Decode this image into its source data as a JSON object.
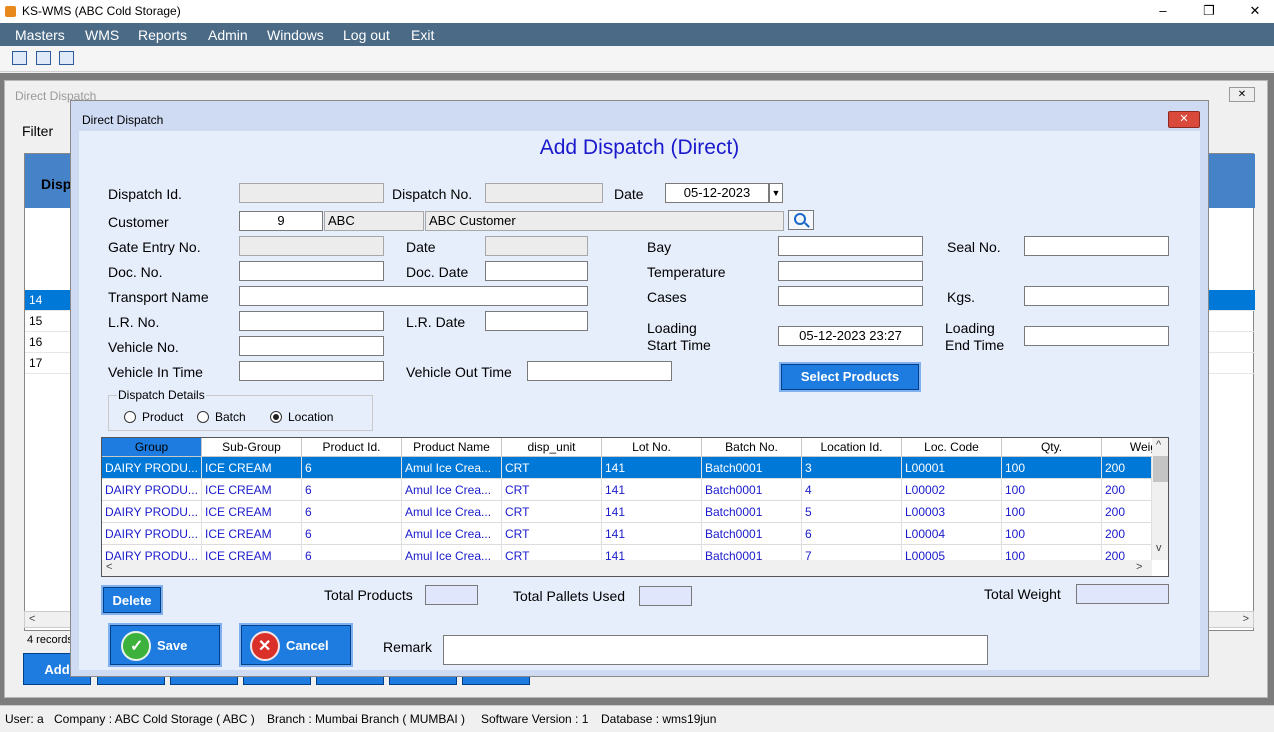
{
  "app": {
    "title": "KS-WMS (ABC Cold Storage)",
    "controls": {
      "minimize": "–",
      "restore": "❐",
      "close": "✕"
    }
  },
  "menu": [
    "Masters",
    "WMS",
    "Reports",
    "Admin",
    "Windows",
    "Log out",
    "Exit"
  ],
  "toolbar": {
    "icons": [
      "edit-icon",
      "list-icon",
      "report-icon"
    ]
  },
  "background_window": {
    "title": "Direct Dispatch",
    "filter_label": "Filter",
    "grid_header": "Disp",
    "rows": [
      "14",
      "15",
      "16",
      "17"
    ],
    "selected_row": "14",
    "records_label": "4 records",
    "add_label": "Add"
  },
  "dialog": {
    "title": "Direct Dispatch",
    "close": "✕",
    "heading": "Add Dispatch (Direct)",
    "labels": {
      "dispatch_id": "Dispatch Id.",
      "dispatch_no": "Dispatch No.",
      "date": "Date",
      "customer": "Customer",
      "gate_entry_no": "Gate Entry No.",
      "gate_date": "Date",
      "bay": "Bay",
      "seal_no": "Seal No.",
      "doc_no": "Doc. No.",
      "doc_date": "Doc. Date",
      "temperature": "Temperature",
      "transport_name": "Transport Name",
      "cases": "Cases",
      "kgs": "Kgs.",
      "lr_no": "L.R. No.",
      "lr_date": "L.R. Date",
      "loading_start_time": [
        "Loading",
        "Start Time"
      ],
      "loading_end_time": [
        "Loading",
        "End Time"
      ],
      "vehicle_no": "Vehicle No.",
      "vehicle_in_time": "Vehicle In Time",
      "vehicle_out_time": "Vehicle Out Time"
    },
    "values": {
      "dispatch_id": "",
      "dispatch_no": "",
      "date": "05-12-2023",
      "customer_id": "9",
      "customer_code": "ABC",
      "customer_name": "ABC Customer",
      "gate_entry_no": "",
      "gate_date": "",
      "bay": "",
      "seal_no": "",
      "doc_no": "",
      "doc_date": "",
      "temperature": "",
      "transport_name": "",
      "cases": "",
      "kgs": "",
      "lr_no": "",
      "lr_date": "",
      "loading_start_time": "05-12-2023 23:27",
      "loading_end_time": "",
      "vehicle_no": "",
      "vehicle_in_time": "",
      "vehicle_out_time": ""
    },
    "select_products_label": "Select Products",
    "dispatch_details": {
      "legend": "Dispatch Details",
      "options": [
        "Product",
        "Batch",
        "Location"
      ],
      "selected": "Location"
    },
    "grid": {
      "columns": [
        "Group",
        "Sub-Group",
        "Product Id.",
        "Product Name",
        "disp_unit",
        "Lot No.",
        "Batch No.",
        "Location Id.",
        "Loc. Code",
        "Qty.",
        "Weig"
      ],
      "rows": [
        [
          "DAIRY PRODU...",
          "ICE CREAM",
          "6",
          "Amul Ice Crea...",
          "CRT",
          "141",
          "Batch0001",
          "3",
          "L00001",
          "100",
          "200"
        ],
        [
          "DAIRY PRODU...",
          "ICE CREAM",
          "6",
          "Amul Ice Crea...",
          "CRT",
          "141",
          "Batch0001",
          "4",
          "L00002",
          "100",
          "200"
        ],
        [
          "DAIRY PRODU...",
          "ICE CREAM",
          "6",
          "Amul Ice Crea...",
          "CRT",
          "141",
          "Batch0001",
          "5",
          "L00003",
          "100",
          "200"
        ],
        [
          "DAIRY PRODU...",
          "ICE CREAM",
          "6",
          "Amul Ice Crea...",
          "CRT",
          "141",
          "Batch0001",
          "6",
          "L00004",
          "100",
          "200"
        ],
        [
          "DAIRY PRODU...",
          "ICE CREAM",
          "6",
          "Amul Ice Crea...",
          "CRT",
          "141",
          "Batch0001",
          "7",
          "L00005",
          "100",
          "200"
        ]
      ],
      "selected_row": 0
    },
    "delete_label": "Delete",
    "totals": {
      "total_products_label": "Total Products",
      "total_products": "",
      "total_pallets_label": "Total Pallets Used",
      "total_pallets": "",
      "total_weight_label": "Total Weight",
      "total_weight": ""
    },
    "save_label": "Save",
    "cancel_label": "Cancel",
    "remark_label": "Remark",
    "remark": ""
  },
  "status_bar": {
    "user": "User: a",
    "company": "Company : ABC Cold Storage ( ABC )",
    "branch": "Branch : Mumbai Branch ( MUMBAI )",
    "version": "Software Version : 1",
    "database": "Database : wms19jun"
  },
  "colors": {
    "menu_bg": "#4a6a86",
    "accent": "#1e7ce0",
    "selection": "#0078d7",
    "heading": "#1a1acc",
    "dialog_bg": "#e6edfb"
  }
}
